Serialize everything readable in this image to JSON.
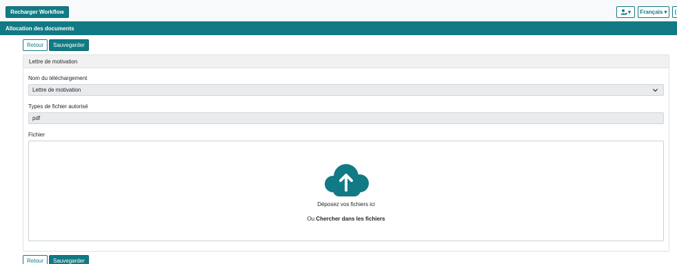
{
  "topbar": {
    "reload_label": "Recharger Workflow",
    "user_caret": "▾",
    "language_label": "Français ▾",
    "extra_label": "("
  },
  "section": {
    "title": "Allocation des documents"
  },
  "actions": {
    "back_label": "Retour",
    "save_label": "Sauvegarder"
  },
  "card": {
    "title": "Lettre de motivation"
  },
  "form": {
    "name_label": "Nom du téléchargement",
    "name_value": "Lettre de motivation",
    "types_label": "Types de fichier autorisé",
    "types_value": "pdf",
    "file_label": "Fichier"
  },
  "dropzone": {
    "drop_text": "Déposez vos fichiers ici",
    "or_text": "Ou",
    "browse_text": "Chercher dans les fichiers"
  },
  "colors": {
    "accent": "#117a84",
    "section_bar": "#117a84",
    "field_bg": "#e9ecef"
  },
  "icons": {
    "user": "user-settings-icon",
    "chevron": "chevron-down-icon",
    "upload": "cloud-upload-icon"
  }
}
